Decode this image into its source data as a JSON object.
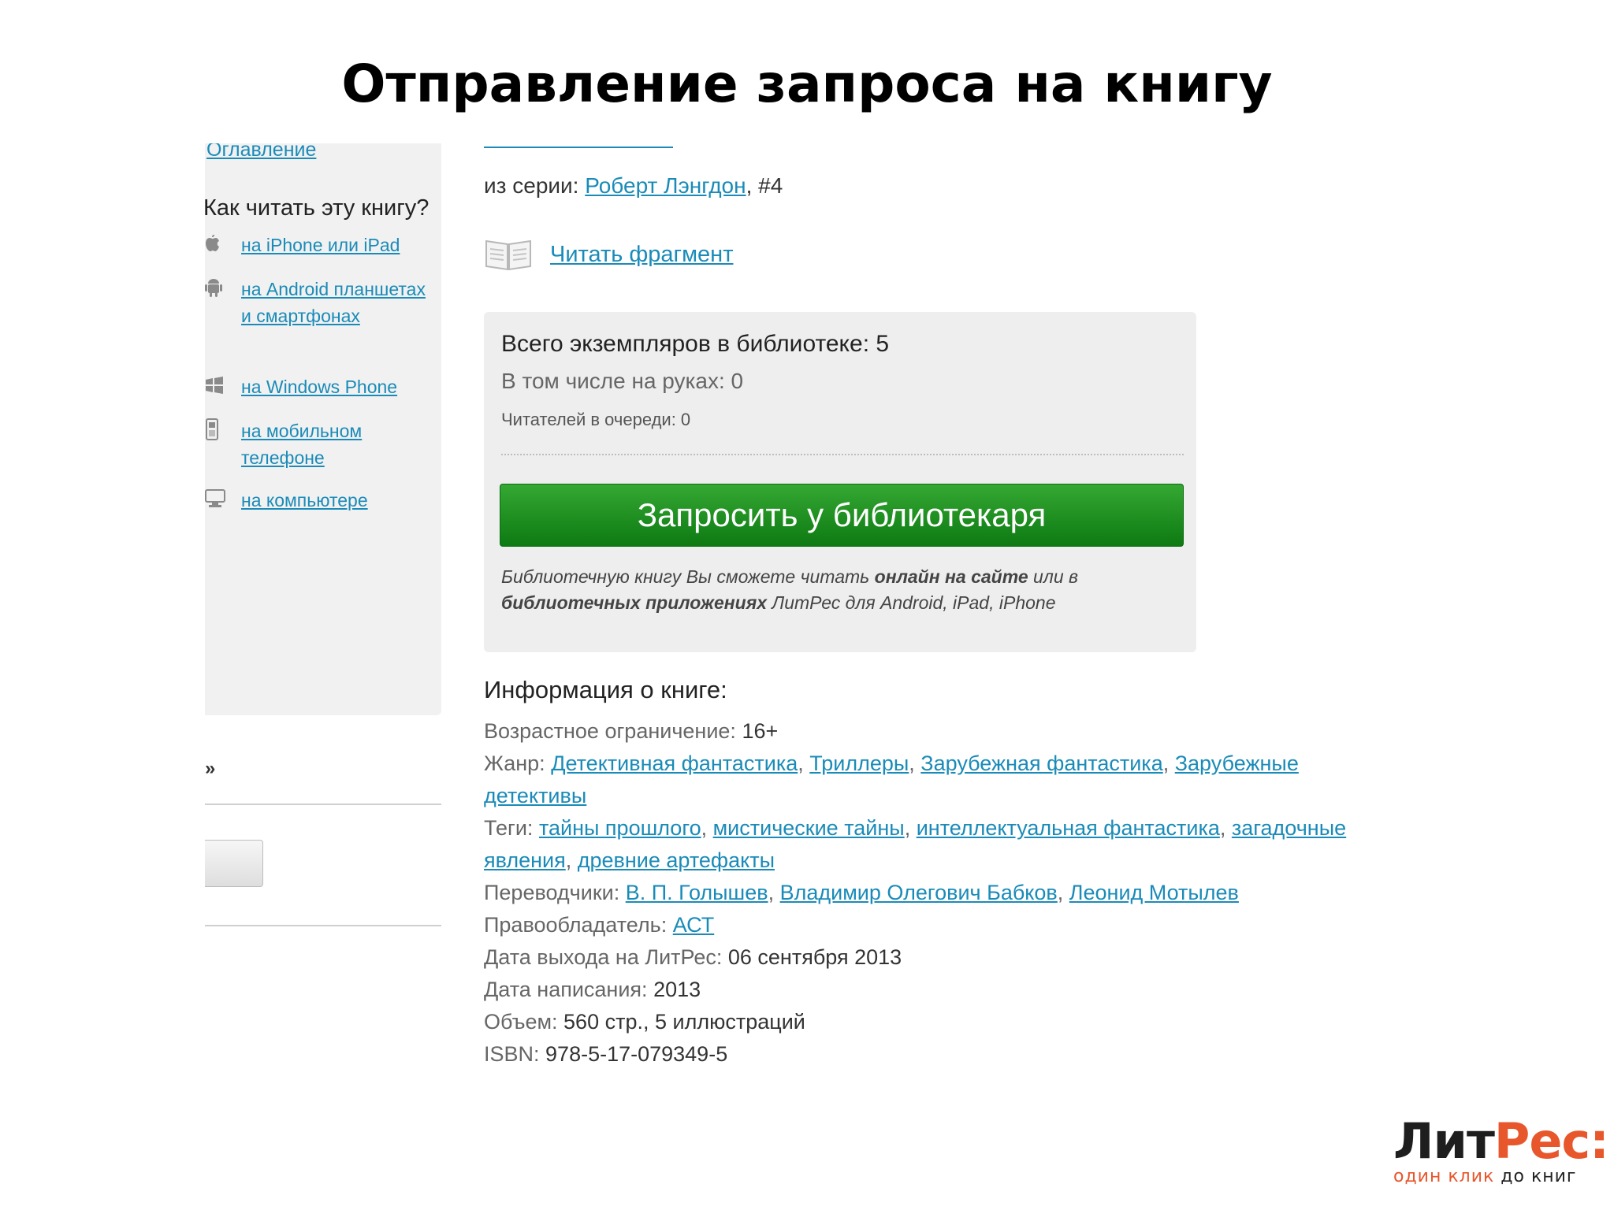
{
  "slide": {
    "title": "Отправление запроса на книгу"
  },
  "sidebar": {
    "toc_link": "Оглавление",
    "howto_title": "Как читать эту книгу?",
    "devices": [
      {
        "label": "на iPhone или iPad",
        "icon": "apple-icon"
      },
      {
        "label": "на Android планшетах и смартфонах",
        "icon": "android-icon"
      },
      {
        "label": "на Windows Phone",
        "icon": "windows-icon"
      },
      {
        "label": "на мобильном телефоне",
        "icon": "mobile-phone-icon"
      },
      {
        "label": "на компьютере",
        "icon": "computer-icon"
      }
    ],
    "mark": "»"
  },
  "series": {
    "prefix": "из серии:",
    "link": "Роберт Лэнгдон",
    "suffix": ", #4"
  },
  "read_fragment": {
    "label": "Читать фрагмент",
    "icon": "open-book-icon"
  },
  "copies": {
    "total": "Всего экземпляров в библиотеке: 5",
    "on_hand": "В том числе на руках: 0",
    "queue": "Читателей в очереди: 0",
    "request_button": "Запросить у библиотекаря",
    "note_1": "Библиотечную книгу Вы сможете читать ",
    "note_2": "онлайн на сайте",
    "note_3": " или в ",
    "note_4": "библиотечных приложениях",
    "note_5": " ЛитРес для Android, iPad, iPhone"
  },
  "info": {
    "title": "Информация о книге:",
    "age_label": "Возрастное ограничение:",
    "age_value": " 16+",
    "genre_label": "Жанр:",
    "genres": [
      "Детективная фантастика",
      "Триллеры",
      "Зарубежная фантастика",
      "Зарубежные детективы"
    ],
    "tags_label": "Теги:",
    "tags": [
      "тайны прошлого",
      "мистические тайны",
      "интеллектуальная фантастика",
      "загадочные явления",
      "древние артефакты"
    ],
    "translators_label": "Переводчики:",
    "translators": [
      "В. П. Голышев",
      "Владимир Олегович Бабков",
      "Леонид Мотылев"
    ],
    "rights_label": "Правообладатель:",
    "rights_value": "АСТ",
    "release_label": "Дата выхода на ЛитРес:",
    "release_value": " 06 сентября 2013",
    "written_label": "Дата написания:",
    "written_value": " 2013",
    "volume_label": "Объем:",
    "volume_value": " 560 стр., 5 иллюстраций",
    "isbn_label": "ISBN:",
    "isbn_value": " 978-5-17-079349-5"
  },
  "logo": {
    "lit": "Лит",
    "res": "Рес:",
    "tag_a": "один клик",
    "tag_b": " до книг"
  },
  "colors": {
    "link": "#1a8bb8",
    "button_green": "#1f9a22",
    "brand_orange": "#e8562c"
  }
}
